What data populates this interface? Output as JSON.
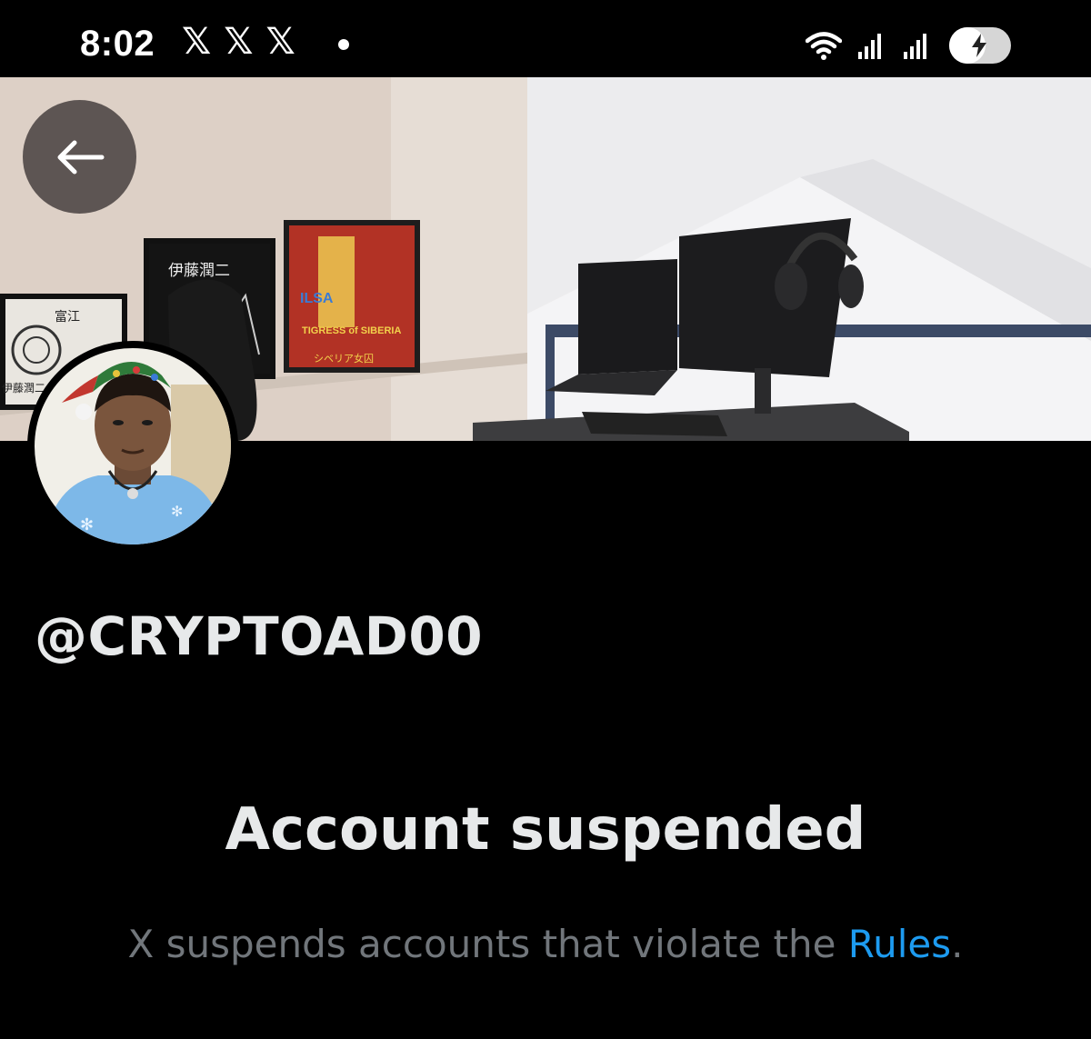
{
  "status_bar": {
    "time": "8:02",
    "app_icons": [
      "𝕏",
      "𝕏",
      "𝕏"
    ],
    "dot": "•",
    "icons": [
      "wifi-icon",
      "signal-icon",
      "signal-icon",
      "battery-charging-icon"
    ]
  },
  "header": {
    "back_icon": "arrow-left-icon"
  },
  "banner": {
    "poster_texts": [
      "伊藤潤二",
      "富江",
      "伊藤潤二",
      "ILSA",
      "TIGRESS of SIBERIA",
      "シベリア女囚"
    ]
  },
  "profile": {
    "handle": "@CRYPTOAD00"
  },
  "suspension": {
    "title": "Account suspended",
    "message_prefix": "X suspends accounts that violate the ",
    "rules_link": "Rules",
    "message_suffix": "."
  },
  "colors": {
    "background": "#000000",
    "text_primary": "#e7e9ea",
    "text_secondary": "#71767b",
    "link": "#1d9bf0"
  }
}
